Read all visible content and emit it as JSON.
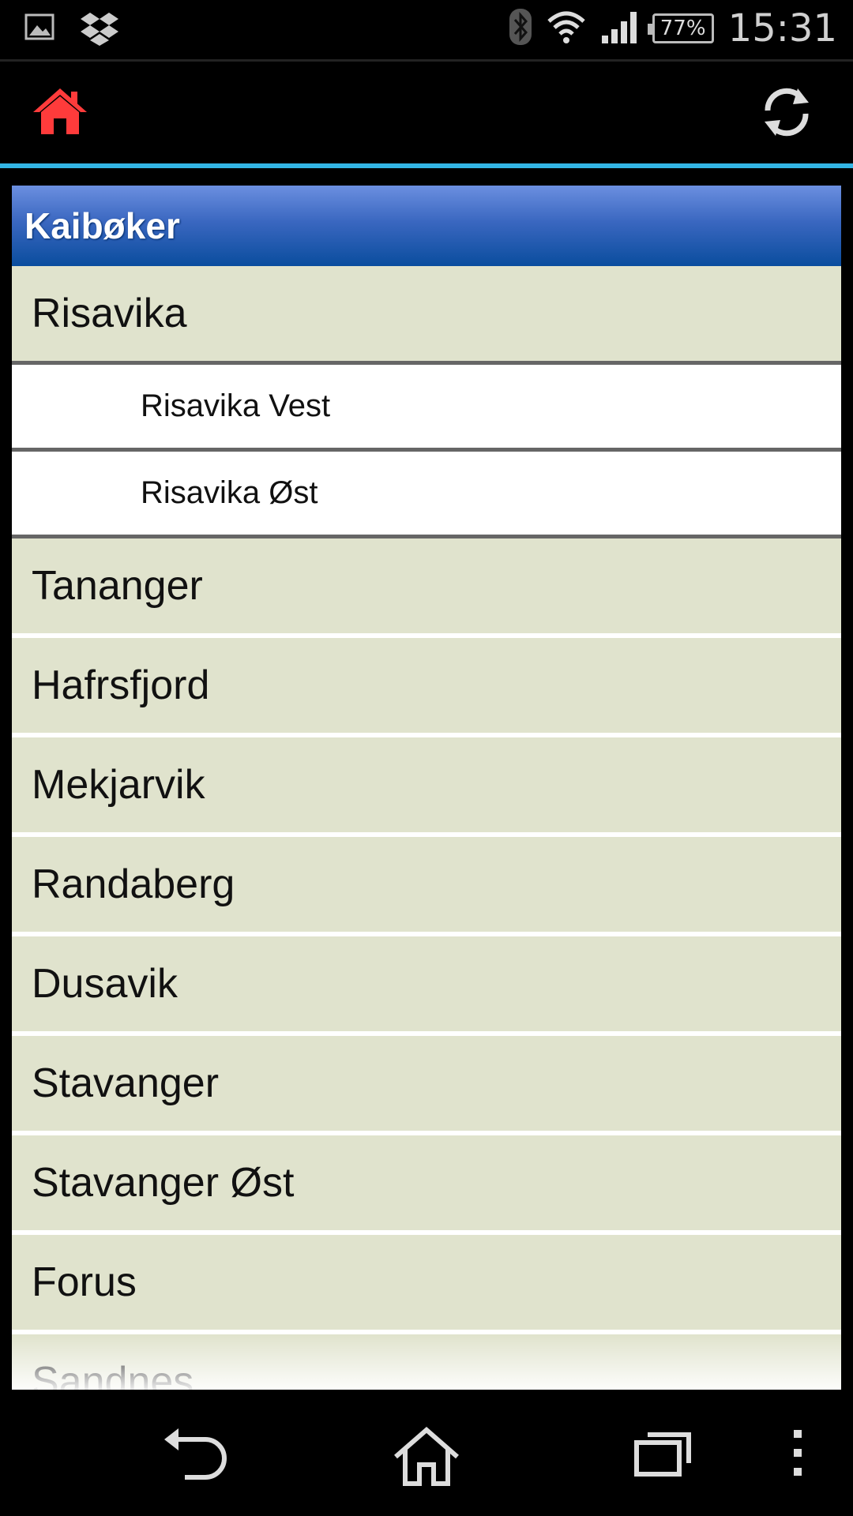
{
  "status_bar": {
    "time": "15:31",
    "battery_percent": "77%",
    "icons": [
      "gallery-icon",
      "dropbox-icon",
      "bluetooth-icon",
      "wifi-icon",
      "signal-icon",
      "battery-icon"
    ]
  },
  "action_bar": {
    "home_icon": "home-icon",
    "refresh_icon": "refresh-icon",
    "accent_color": "#33b5e5",
    "home_color": "#ff3b3b"
  },
  "list": {
    "header": "Kaibøker",
    "groups": [
      {
        "label": "Risavika",
        "expanded": true,
        "children": [
          "Risavika Vest",
          "Risavika Øst"
        ]
      },
      {
        "label": "Tananger"
      },
      {
        "label": "Hafrsfjord"
      },
      {
        "label": "Mekjarvik"
      },
      {
        "label": "Randaberg"
      },
      {
        "label": "Dusavik"
      },
      {
        "label": "Stavanger"
      },
      {
        "label": "Stavanger Øst"
      },
      {
        "label": "Forus"
      },
      {
        "label": "Sandnes"
      }
    ]
  },
  "nav_bar": {
    "icons": [
      "back-icon",
      "home-icon",
      "recent-apps-icon",
      "overflow-menu-icon"
    ]
  }
}
